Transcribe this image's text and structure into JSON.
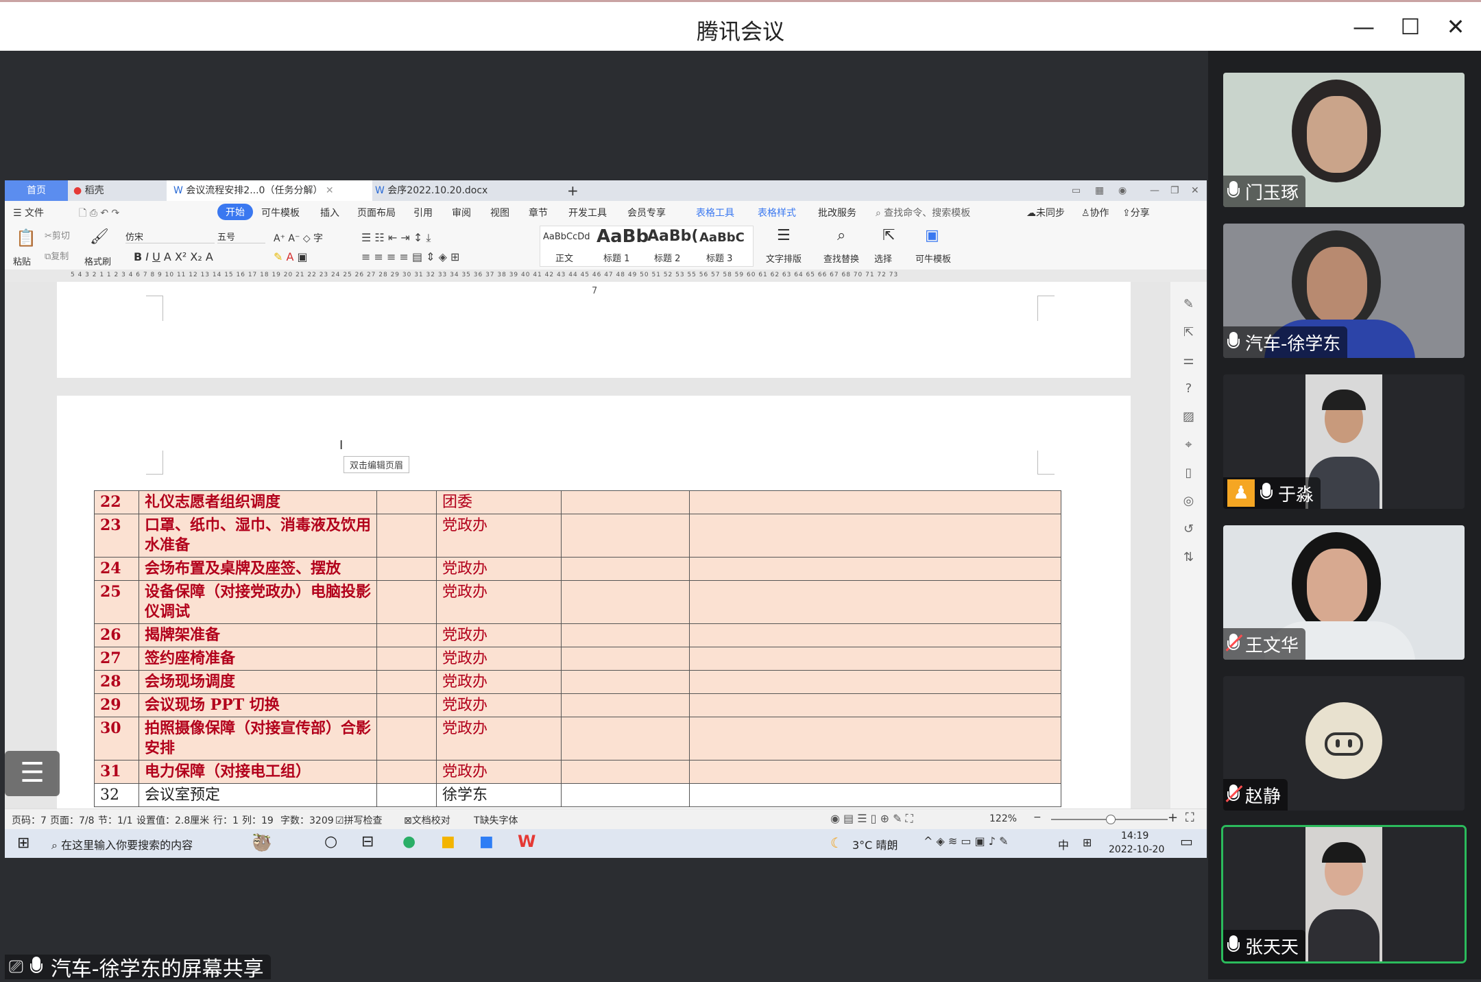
{
  "window": {
    "title": "腾讯会议",
    "minimize": "—",
    "maximize": "☐",
    "close": "✕"
  },
  "share": {
    "label": "汽车-徐学东的屏幕共享"
  },
  "participants": [
    {
      "name": "门玉琢",
      "mic": "on",
      "video": "woman-1"
    },
    {
      "name": "汽车-徐学东",
      "mic": "on",
      "video": "man-1"
    },
    {
      "name": "于淼",
      "mic": "on",
      "video": "man-2",
      "host": true
    },
    {
      "name": "王文华",
      "mic": "off",
      "video": "woman-2"
    },
    {
      "name": "赵静",
      "mic": "off",
      "video": "pig-avatar"
    },
    {
      "name": "张天天",
      "mic": "on",
      "video": "woman-3",
      "active": true
    }
  ],
  "wps": {
    "tabs": {
      "home": "首页",
      "daoke": "稻壳",
      "doc1": "会议流程安排2...0（任务分解）",
      "doc2": "会序2022.10.20.docx",
      "add": "+"
    },
    "menu": {
      "file": "文件",
      "start": "开始",
      "template": "可牛模板",
      "insert": "插入",
      "layout": "页面布局",
      "reference": "引用",
      "review": "审阅",
      "view": "视图",
      "chapter": "章节",
      "dev": "开发工具",
      "member": "会员专享",
      "tabletools": "表格工具",
      "tablestyle": "表格样式",
      "batch": "批改服务",
      "search": "查找命令、搜索模板",
      "unsync": "未同步",
      "collab": "协作",
      "share": "分享"
    },
    "ribbon": {
      "paste": "粘贴",
      "cut": "剪切",
      "copy": "复制",
      "formatpainter": "格式刷",
      "font": "仿宋",
      "size": "五号",
      "style_normal_preview": "AaBbCcDd",
      "style_normal": "正文",
      "style_h1_preview": "AaBb",
      "style_h1": "标题 1",
      "style_h2_preview": "AaBb(",
      "style_h2": "标题 2",
      "style_h3_preview": "AaBbC",
      "style_h3": "标题 3",
      "textlayout": "文字排版",
      "findreplace": "查找替换",
      "select": "选择",
      "kntemplate": "可牛模板"
    },
    "ruler": "5 4 3 2 1 1 2 3 4 6 7 8 9 10 11 12 13 14 15 16 17 18 19 20 21 22 23 24 25 26 27 28 29 30 31 32 33 34 35 36 37 38 39 40 41 42 43 44 45 46 47 48 49 50 51 52 53 55 56 57 58 59 60 61 62 63 64 65 66 67 68 70 71 72 73",
    "page_number": "7",
    "tooltip": "双击编辑页眉",
    "table": [
      {
        "no": "22",
        "task": "礼仪志愿者组织调度",
        "dept": "团委",
        "hl": true
      },
      {
        "no": "23",
        "task": "口罩、纸巾、湿巾、消毒液及饮用水准备",
        "dept": "党政办",
        "hl": true
      },
      {
        "no": "24",
        "task": "会场布置及桌牌及座签、摆放",
        "dept": "党政办",
        "hl": true
      },
      {
        "no": "25",
        "task": "设备保障（对接党政办）电脑投影仪调试",
        "dept": "党政办",
        "hl": true
      },
      {
        "no": "26",
        "task": "揭牌架准备",
        "dept": "党政办",
        "hl": true
      },
      {
        "no": "27",
        "task": "签约座椅准备",
        "dept": "党政办",
        "hl": true
      },
      {
        "no": "28",
        "task": "会场现场调度",
        "dept": "党政办",
        "hl": true
      },
      {
        "no": "29",
        "task": "会议现场 PPT 切换",
        "dept": "党政办",
        "hl": true
      },
      {
        "no": "30",
        "task": "拍照摄像保障（对接宣传部）合影安排",
        "dept": "党政办",
        "hl": true
      },
      {
        "no": "31",
        "task": "电力保障（对接电工组）",
        "dept": "党政办",
        "hl": true
      },
      {
        "no": "32",
        "task": "会议室预定",
        "dept": "徐学东",
        "hl": false
      }
    ],
    "status": {
      "page": "页码：7",
      "pages": "页面：7/8",
      "section": "节：1/1",
      "setting": "设置值：2.8厘米",
      "row": "行：1",
      "col": "列：19",
      "words": "字数：3209",
      "spell": "拼写检查",
      "proof": "文档校对",
      "missingfont": "缺失字体",
      "zoom": "122%"
    },
    "taskbar": {
      "search": "在这里输入你要搜索的内容",
      "weather": "3°C 晴朗",
      "ime": "中",
      "time": "14:19",
      "date": "2022-10-20"
    }
  }
}
